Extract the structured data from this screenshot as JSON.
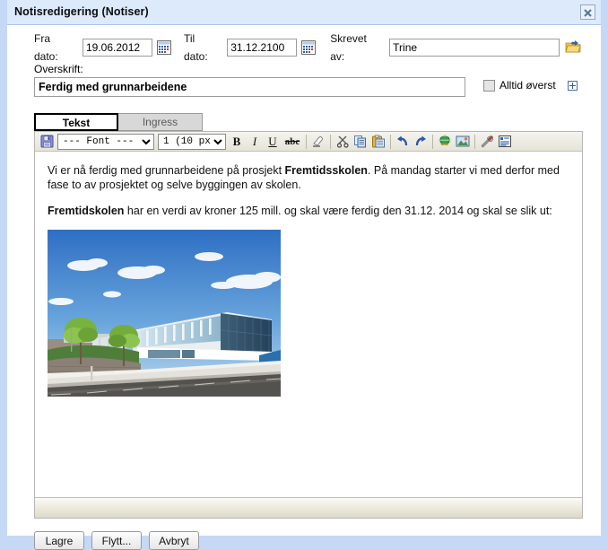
{
  "window": {
    "title": "Notisredigering (Notiser)",
    "close_icon": "close-icon"
  },
  "form": {
    "from_date_label": "Fra dato:",
    "from_date_value": "19.06.2012",
    "from_date_picker_icon": "calendar-icon",
    "to_date_label": "Til dato:",
    "to_date_value": "31.12.2100",
    "to_date_picker_icon": "calendar-icon",
    "author_label": "Skrevet av:",
    "author_value": "Trine",
    "author_browse_icon": "folder-arrow-icon",
    "heading_label": "Overskrift:",
    "heading_value": "Ferdig med grunnarbeidene",
    "always_top_label": "Alltid øverst",
    "always_top_checked": false,
    "expand_icon": "expand-plus-icon"
  },
  "tabs": [
    {
      "label": "Tekst",
      "active": true
    },
    {
      "label": "Ingress",
      "active": false
    }
  ],
  "toolbar": {
    "save_icon": "floppy-save-icon",
    "font_select_value": "--- Font ---",
    "font_options": [
      "--- Font ---"
    ],
    "size_select_value": "1 (10 px)",
    "size_options": [
      "1 (10 px)"
    ],
    "bold_label": "B",
    "italic_label": "I",
    "underline_label": "U",
    "strike_label": "abc",
    "eraser_icon": "eraser-icon",
    "cut_icon": "scissors-icon",
    "copy_icon": "copy-icon",
    "paste_icon": "paste-icon",
    "undo_icon": "undo-arrow-icon",
    "redo_icon": "redo-arrow-icon",
    "link_icon": "globe-link-icon",
    "image_icon": "picture-icon",
    "tools_icon": "hammer-wrench-icon",
    "properties_icon": "document-properties-icon"
  },
  "content": {
    "paragraph1": {
      "part1": "Vi er nå ferdig med grunnarbeidene på prosjekt ",
      "bold1": "Fremtidsskolen",
      "part2": ". På mandag starter vi med derfor med fase to av prosjektet og selve byggingen av skolen."
    },
    "paragraph2": {
      "bold1": "Fremtidskolen",
      "part2": " har en verdi av kroner 125 mill. og skal være ferdig den 31.12. 2014 og skal se slik ut:"
    },
    "image_alt": "school-building-photo"
  },
  "buttons": [
    {
      "label": "Lagre",
      "name": "save-button"
    },
    {
      "label": "Flytt...",
      "name": "move-button"
    },
    {
      "label": "Avbryt",
      "name": "cancel-button"
    }
  ],
  "colors": {
    "window_chrome": "#c5d9f7",
    "titlebar": "#dceafc",
    "toolbar_start": "#f4f3ee",
    "toolbar_end": "#e6e4d8",
    "active_tab_border": "#000000",
    "inactive_tab_bg": "#d8d8d8"
  }
}
